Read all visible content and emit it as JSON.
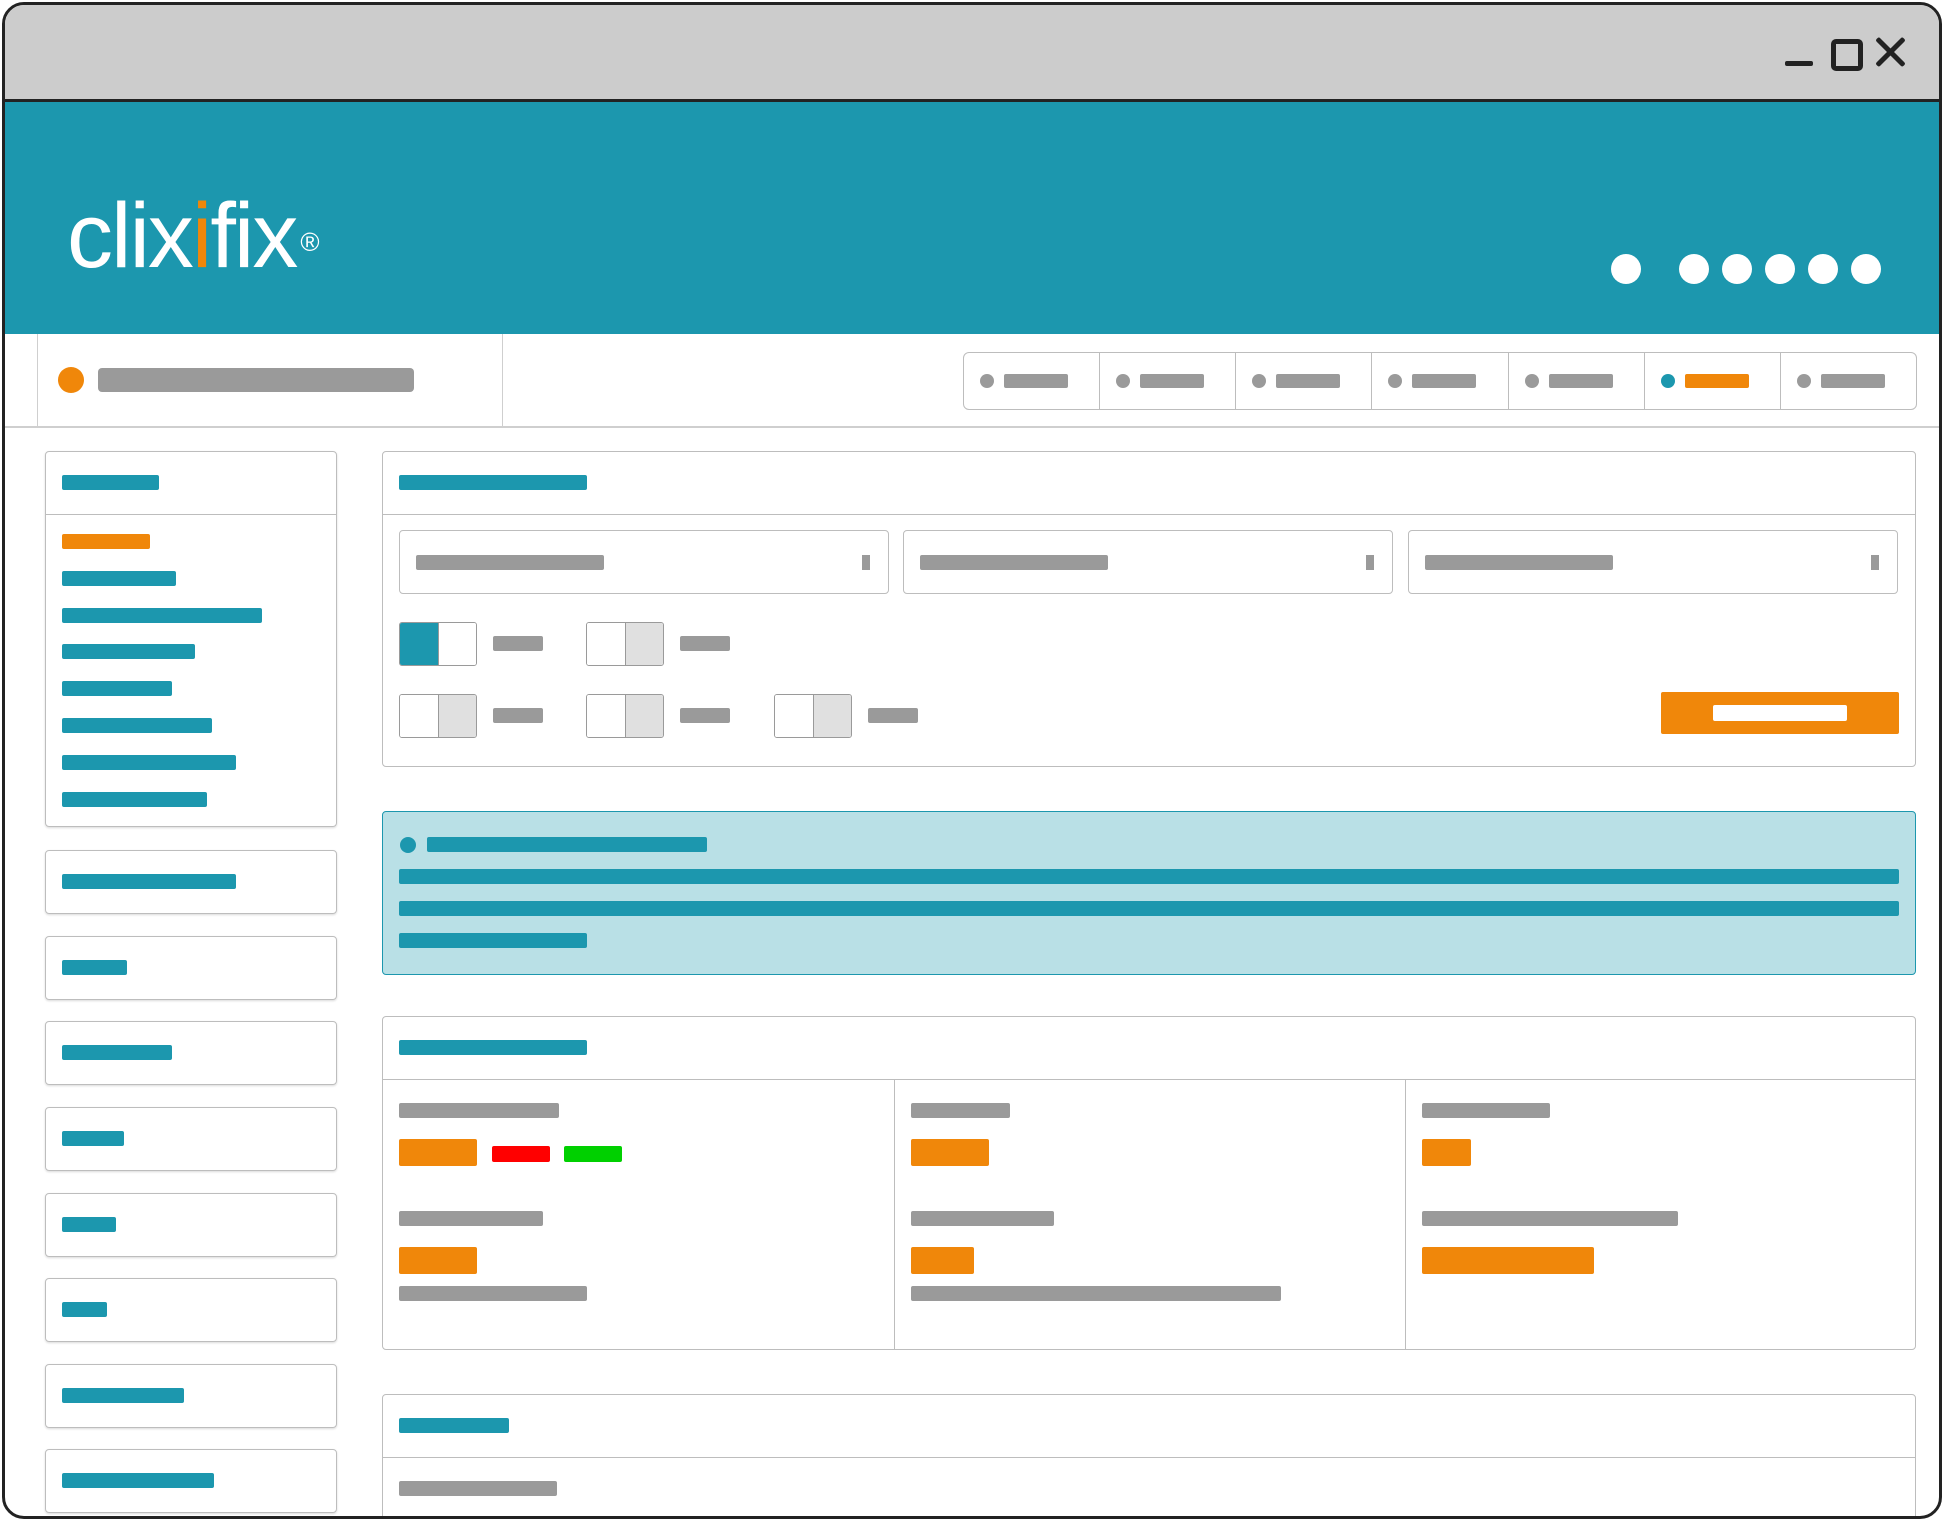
{
  "app": {
    "logo_text_start": "clix",
    "logo_text_accent": "i",
    "logo_text_end": "fix",
    "logo_reg": "®"
  },
  "colors": {
    "brand_teal": "#1c97ae",
    "accent_orange": "#f0870a",
    "info_background": "#b9e0e6",
    "status_red": "#ff0000",
    "status_green": "#00d000"
  },
  "window_controls": [
    "minimize-icon",
    "maximize-icon",
    "close-icon"
  ],
  "toolbar": {
    "tabs_count": 7,
    "active_tab_index": 5
  },
  "form": {
    "toggles": [
      {
        "state": "on"
      },
      {
        "state": "off"
      },
      {
        "state": "off"
      },
      {
        "state": "off"
      },
      {
        "state": "off"
      }
    ]
  }
}
